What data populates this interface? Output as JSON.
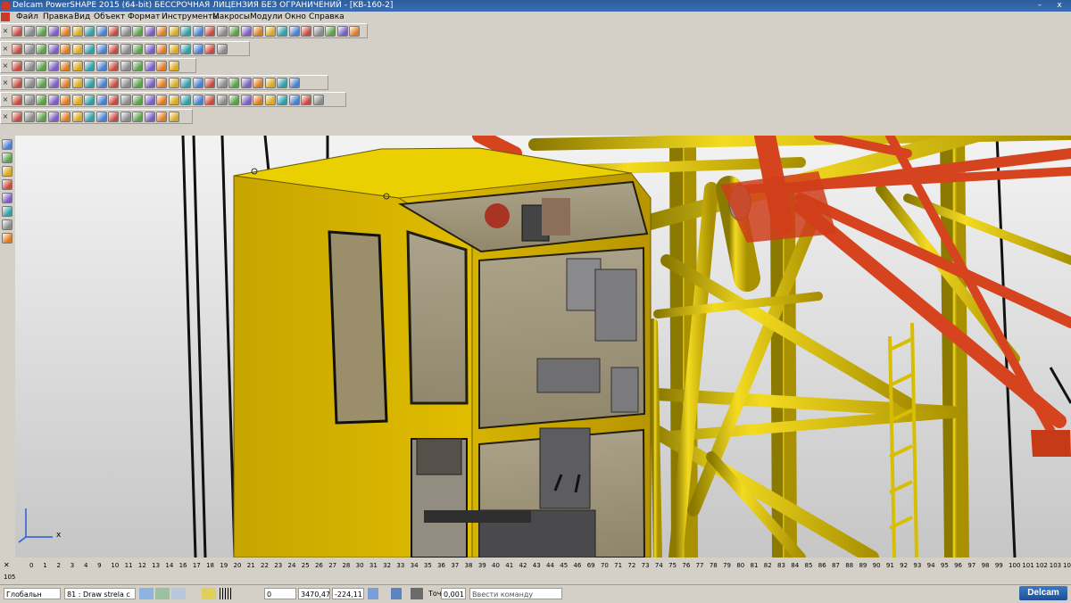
{
  "window": {
    "title": "Delcam PowerSHAPE 2015 (64-bit) БЕССРОЧНАЯ ЛИЦЕНЗИЯ БЕЗ ОГРАНИЧЕНИЙ - [KB-160-2]",
    "minimize": "–",
    "close": "x"
  },
  "menu": [
    "Файл",
    "Правка",
    "Вид",
    "Объект",
    "Формат",
    "Инструменты",
    "Макросы",
    "Модули",
    "Окно",
    "Справка"
  ],
  "ruler": {
    "labels": [
      "0",
      "1",
      "2",
      "3",
      "4",
      "9",
      "10",
      "11",
      "12",
      "13",
      "14",
      "16",
      "17",
      "18",
      "19",
      "20",
      "21",
      "22",
      "23",
      "24",
      "25",
      "26",
      "27",
      "28",
      "30",
      "31",
      "32",
      "33",
      "34",
      "35",
      "36",
      "37",
      "38",
      "39",
      "40",
      "41",
      "42",
      "43",
      "44",
      "45",
      "46",
      "69",
      "70",
      "71",
      "72",
      "73",
      "74",
      "75",
      "76",
      "77",
      "78",
      "79",
      "80",
      "81",
      "82",
      "83",
      "84",
      "85",
      "86",
      "87",
      "88",
      "89",
      "90",
      "91",
      "92",
      "93",
      "94",
      "95",
      "96",
      "97",
      "98",
      "99",
      "100",
      "101",
      "102",
      "103",
      "104"
    ],
    "second_line": "105"
  },
  "status": {
    "workplane": "Глобальн",
    "level": "81 : Draw strela c",
    "coord_a": "0",
    "coord_x": "3470,47",
    "coord_y": "-224,11",
    "tol_label": "Точ",
    "tol_value": "0,001",
    "command_placeholder": "Ввести команду",
    "brand": "Delcam"
  },
  "triad": {
    "x_label": "x"
  },
  "icons": {
    "toolbar_1": "file-new-open-save-print-undo-redo-select-icons",
    "toolbar_2": "view-orientation-zoom-shading-icons",
    "toolbar_3": "object-attributes-level-material-icons",
    "toolbar_4": "surface-creation-icons",
    "toolbar_5": "solid-feature-icons",
    "toolbar_6": "render-and-display-icons",
    "left": "selection-and-object-creation-icons"
  },
  "colors": {
    "cab_yellow": "#d2b000",
    "truss_yellow": "#e4c600",
    "truss_red": "#d8421e",
    "titlebar": "#2c5d9c"
  }
}
